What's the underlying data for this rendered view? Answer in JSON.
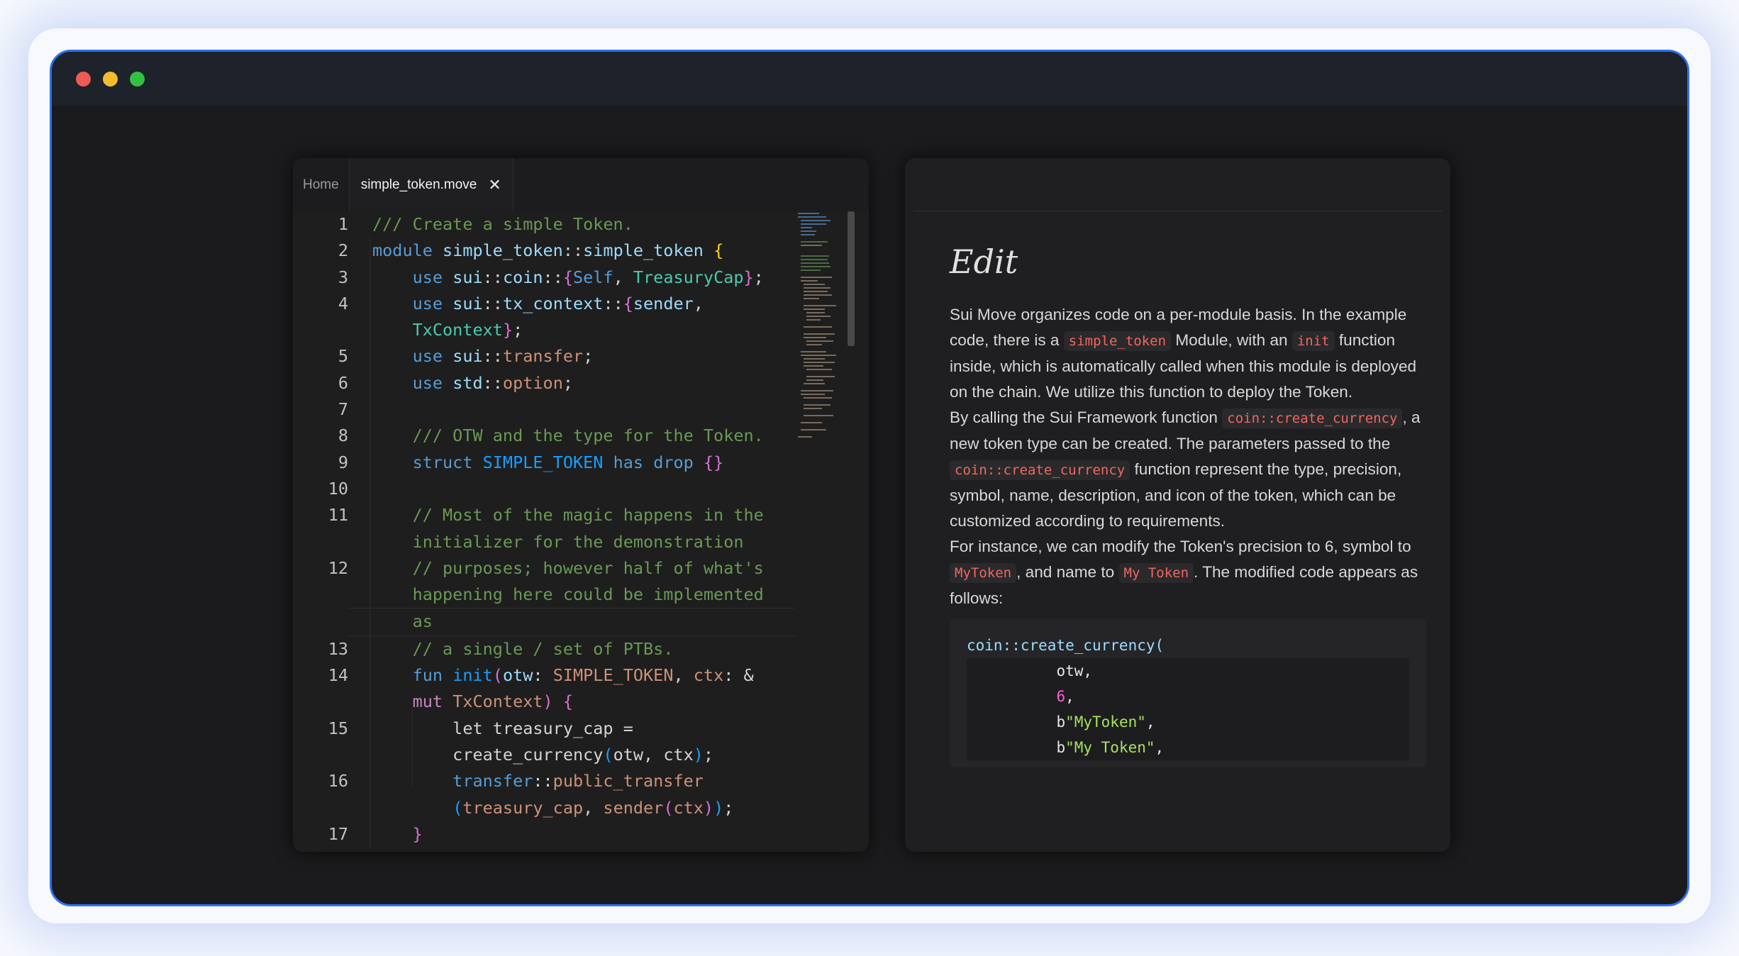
{
  "window": {
    "controls": [
      "close",
      "minimize",
      "maximize"
    ],
    "colors": {
      "close": "#ef5a55",
      "minimize": "#f3bc2f",
      "maximize": "#34c142",
      "border": "#2f6ff5"
    }
  },
  "tabs": [
    {
      "label": "Home",
      "active": false
    },
    {
      "label": "simple_token.move",
      "active": true
    }
  ],
  "editor": {
    "line_numbers": [
      "1",
      "2",
      "3",
      "4",
      "",
      "5",
      "6",
      "7",
      "8",
      "9",
      "10",
      "11",
      "",
      "12",
      "",
      "",
      "13",
      "14",
      "",
      "15",
      "",
      "16",
      "",
      "17"
    ]
  },
  "doc": {
    "title": "Edit",
    "p1_a": "Sui Move organizes code on a per-module basis. In the example code, there is a ",
    "p1_code1": "simple_token",
    "p1_b": " Module, with an ",
    "p1_code2": "init",
    "p1_c": " function inside, which is automatically called when this module is deployed on the chain. We utilize this function to deploy the Token.",
    "p2_a": "By calling the Sui Framework function ",
    "p2_code1": "coin::create_currency",
    "p2_b": ", a new token type can be created. The parameters passed to the ",
    "p2_code2": "coin::create_currency",
    "p2_c": " function represent the type, precision, symbol, name, description, and icon of the token, which can be customized according to requirements.",
    "p3_a": "For instance, we can modify the Token's precision to 6, symbol to ",
    "p3_code1": "MyToken",
    "p3_b": ", and name to ",
    "p3_code2": "My Token",
    "p3_c": ". The modified code appears as follows:",
    "code_block": {
      "l1": "coin::create_currency(",
      "l2": "otw,",
      "l3": "6",
      "l3_tail": ",",
      "l4_prefix": "b",
      "l4_str": "\"MyToken\"",
      "l4_tail": ",",
      "l5_prefix": "b",
      "l5_str": "\"My Token\"",
      "l5_tail": ","
    }
  }
}
